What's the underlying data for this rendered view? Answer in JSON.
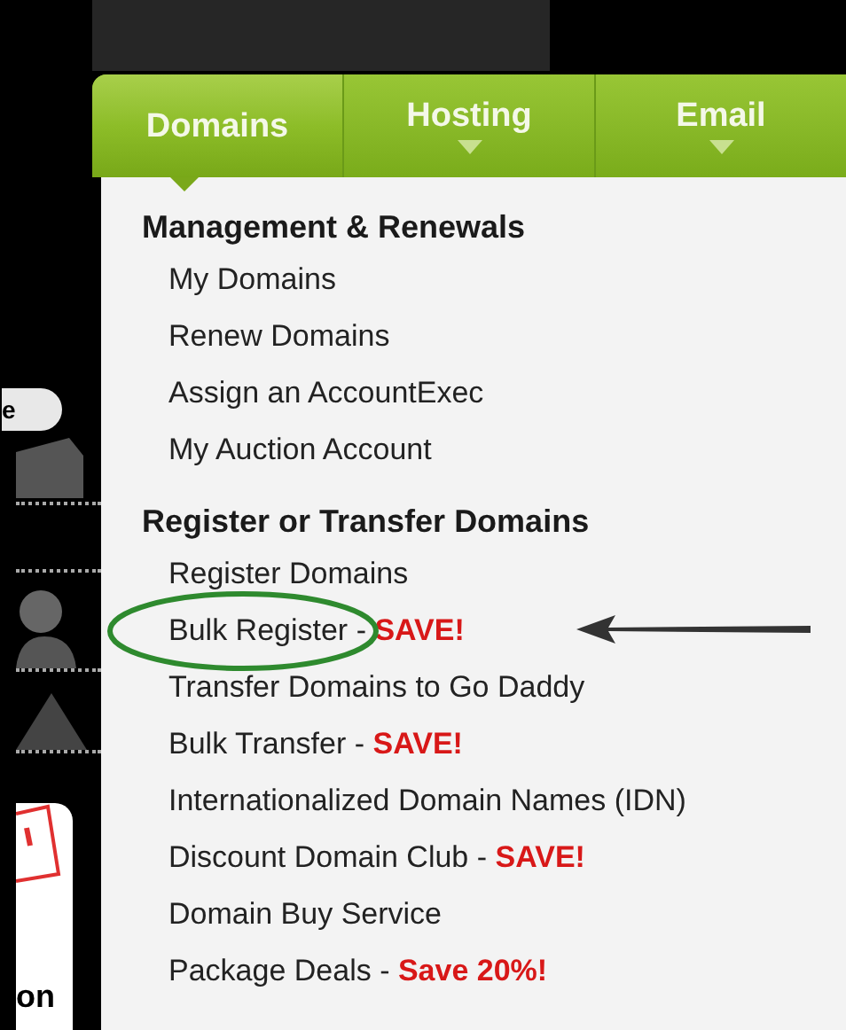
{
  "tabs": [
    {
      "label": "Domains",
      "selected": true,
      "has_menu": false
    },
    {
      "label": "Hosting",
      "selected": false,
      "has_menu": true
    },
    {
      "label": "Email",
      "selected": false,
      "has_menu": true
    }
  ],
  "left_strip": {
    "button_text": "e",
    "label_text": "on"
  },
  "menu": {
    "sections": [
      {
        "heading": "Management & Renewals",
        "items": [
          {
            "label": "My Domains"
          },
          {
            "label": "Renew Domains"
          },
          {
            "label": "Assign an AccountExec"
          },
          {
            "label": "My Auction Account"
          }
        ]
      },
      {
        "heading": "Register or Transfer Domains",
        "items": [
          {
            "label": "Register Domains"
          },
          {
            "label": "Bulk Register - ",
            "promo": "SAVE!",
            "circled": true
          },
          {
            "label": "Transfer Domains to Go Daddy"
          },
          {
            "label": "Bulk Transfer - ",
            "promo": "SAVE!"
          },
          {
            "label": "Internationalized Domain Names (IDN)"
          },
          {
            "label": "Discount Domain Club - ",
            "promo": "SAVE!"
          },
          {
            "label": "Domain Buy Service"
          },
          {
            "label": "Package Deals - ",
            "promo": "Save 20%!"
          }
        ]
      }
    ]
  }
}
